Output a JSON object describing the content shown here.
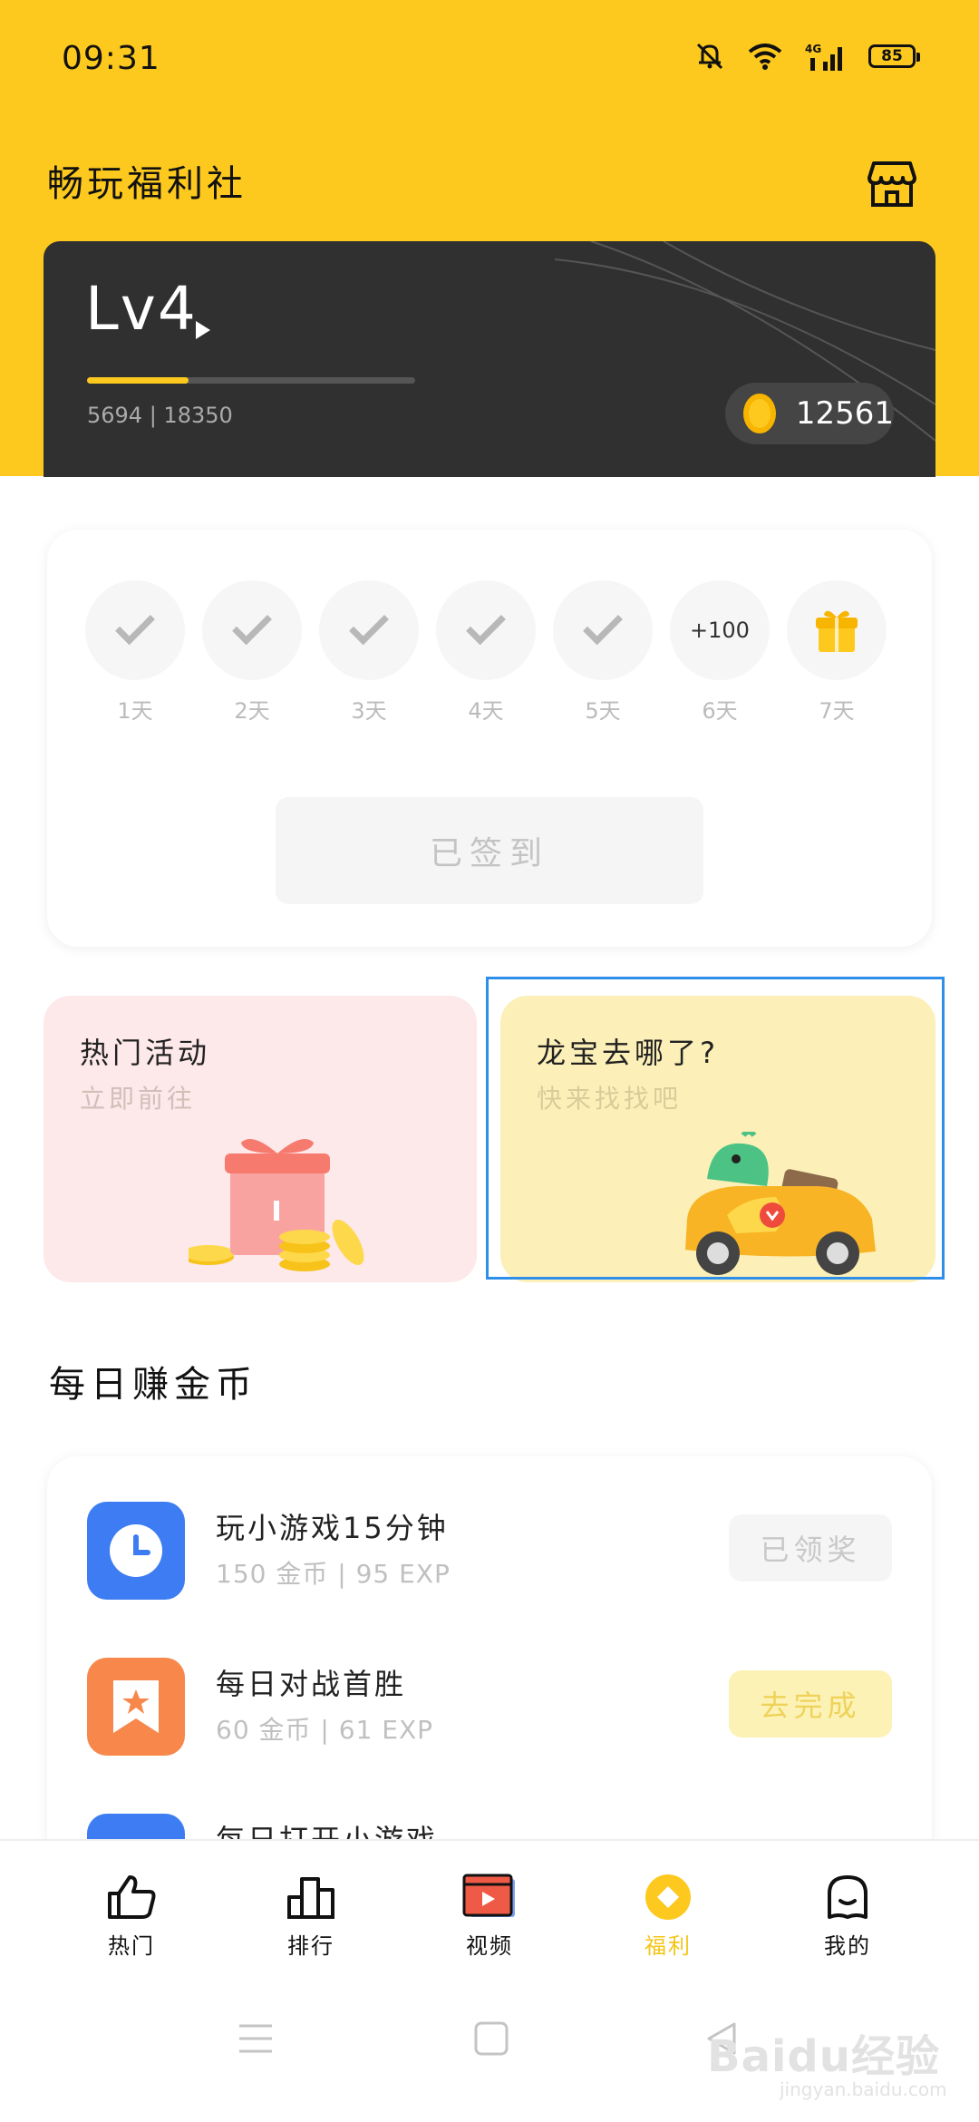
{
  "status_bar": {
    "time": "09:31",
    "network": "4G",
    "battery": "85",
    "icons": [
      "mute-bell-icon",
      "wifi-icon",
      "signal-icon",
      "battery-icon"
    ]
  },
  "header": {
    "title": "畅玩福利社",
    "store_icon": "store-icon"
  },
  "level_card": {
    "level": "Lv4",
    "exp_current": "5694",
    "exp_total": "18350",
    "exp_text": "5694 | 18350",
    "exp_progress": 0.31,
    "coins": "12561"
  },
  "signin": {
    "days": [
      {
        "label": "1天",
        "state": "checked"
      },
      {
        "label": "2天",
        "state": "checked"
      },
      {
        "label": "3天",
        "state": "checked"
      },
      {
        "label": "4天",
        "state": "checked"
      },
      {
        "label": "5天",
        "state": "checked"
      },
      {
        "label": "6天",
        "state": "bonus",
        "bonus": "+100"
      },
      {
        "label": "7天",
        "state": "gift"
      }
    ],
    "button_label": "已签到"
  },
  "promos": [
    {
      "title": "热门活动",
      "subtitle": "立即前往"
    },
    {
      "title": "龙宝去哪了?",
      "subtitle": "快来找找吧"
    }
  ],
  "daily_section": {
    "title": "每日赚金币",
    "tasks": [
      {
        "title": "玩小游戏15分钟",
        "meta": "150 金币 | 95 EXP",
        "button": "已领奖",
        "icon": "clock-icon",
        "color": "#3D7CF2"
      },
      {
        "title": "每日对战首胜",
        "meta": "60 金币 | 61 EXP",
        "button": "去完成",
        "icon": "star-bookmark-icon",
        "color": "#F7874A"
      },
      {
        "title": "每日打开小游戏",
        "meta": "",
        "button": "",
        "icon": "app-icon",
        "color": "#3D7CF2"
      }
    ]
  },
  "tab_bar": {
    "tabs": [
      {
        "label": "热门",
        "icon": "thumbs-up-icon"
      },
      {
        "label": "排行",
        "icon": "ranking-icon"
      },
      {
        "label": "视频",
        "icon": "video-icon"
      },
      {
        "label": "福利",
        "icon": "coin-icon",
        "active": true
      },
      {
        "label": "我的",
        "icon": "profile-icon"
      }
    ]
  },
  "watermark": {
    "brand": "Baidu经验",
    "site": "jingyan.baidu.com"
  },
  "colors": {
    "accent": "#FDC91E",
    "dark_card": "#303030",
    "selection": "#2F8FE8"
  }
}
